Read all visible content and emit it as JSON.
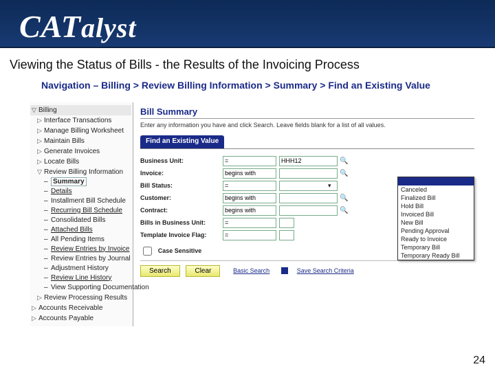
{
  "brand": {
    "name_html": "CATalyst",
    "a": "CAT",
    "b": "alyst"
  },
  "page_title": "Viewing the Status of Bills - the Results of the Invoicing Process",
  "nav_path": "Navigation – Billing > Review Billing Information > Summary > Find an Existing Value",
  "page_number": "24",
  "tree": {
    "top": "Billing",
    "items": [
      "Interface Transactions",
      "Manage Billing Worksheet",
      "Maintain Bills",
      "Generate Invoices",
      "Locate Bills"
    ],
    "group": "Review Billing Information",
    "group_items": [
      {
        "t": "Summary",
        "sel": true,
        "u": false
      },
      {
        "t": "Details",
        "u": true
      },
      {
        "t": "Installment Bill Schedule",
        "u": false
      },
      {
        "t": "Recurring Bill Schedule",
        "u": true
      },
      {
        "t": "Consolidated Bills",
        "u": false
      },
      {
        "t": "Attached Bills",
        "u": true
      },
      {
        "t": "All Pending Items",
        "u": false
      },
      {
        "t": "Review Entries by Invoice",
        "u": true
      },
      {
        "t": "Review Entries by Journal",
        "u": false
      },
      {
        "t": "Adjustment History",
        "u": false
      },
      {
        "t": "Review Line History",
        "u": true
      },
      {
        "t": "View Supporting Documentation",
        "u": false
      }
    ],
    "after": [
      "Review Processing Results",
      "Accounts Receivable",
      "Accounts Payable"
    ]
  },
  "panel": {
    "heading": "Bill Summary",
    "hint": "Enter any information you have and click Search. Leave fields blank for a list of all values.",
    "tab": "Find an Existing Value",
    "rows": [
      {
        "label": "Business Unit:",
        "op": "=",
        "val": "HHH12",
        "lookup": true
      },
      {
        "label": "Invoice:",
        "op": "begins with",
        "val": "",
        "lookup": true
      },
      {
        "label": "Bill Status:",
        "op": "=",
        "val": "",
        "lookup": false,
        "dd": true
      },
      {
        "label": "Customer:",
        "op": "begins with",
        "val": "",
        "lookup": true
      },
      {
        "label": "Contract:",
        "op": "begins with",
        "val": "",
        "lookup": true
      },
      {
        "label": "Bills in Business Unit:",
        "op": "=",
        "val": "",
        "lookup": false,
        "narrow": true
      },
      {
        "label": "Template Invoice Flag:",
        "op": "=",
        "val": "",
        "lookup": false,
        "narrow": true
      }
    ],
    "case_label": "Case Sensitive",
    "search": "Search",
    "clear": "Clear",
    "basic": "Basic Search",
    "save": "Save Search Criteria"
  },
  "dropdown": {
    "items": [
      "",
      "Canceled",
      "Finalized Bill",
      "Hold Bill",
      "Invoiced Bill",
      "New Bill",
      "Pending Approval",
      "Ready to Invoice",
      "Temporary Bill",
      "Temporary Ready Bill"
    ]
  }
}
